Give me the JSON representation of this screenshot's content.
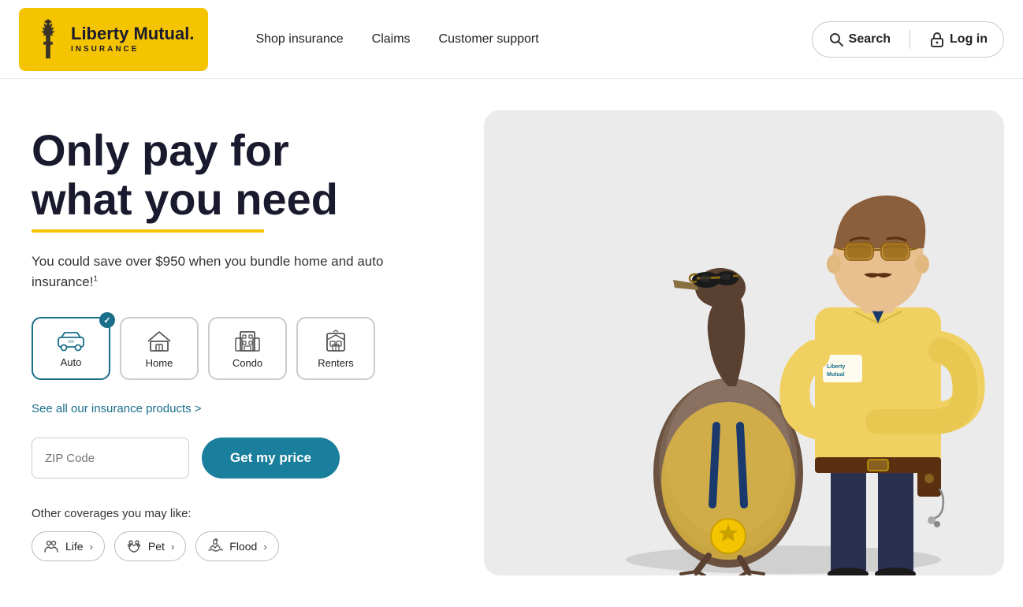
{
  "nav": {
    "logo": {
      "main": "Liberty Mutual.",
      "sub": "INSURANCE"
    },
    "links": [
      {
        "id": "shop",
        "label": "Shop insurance"
      },
      {
        "id": "claims",
        "label": "Claims"
      },
      {
        "id": "support",
        "label": "Customer support"
      }
    ],
    "search_label": "Search",
    "login_label": "Log in"
  },
  "hero": {
    "title_line1": "Only pay for",
    "title_line2": "what you need",
    "subtitle": "You could save over $950 when you bundle home and auto insurance!",
    "subtitle_sup": "1",
    "see_all_label": "See all our insurance products >",
    "zip_placeholder": "ZIP Code",
    "cta_label": "Get my price",
    "other_label": "Other coverages you may like:",
    "ins_tabs": [
      {
        "id": "auto",
        "label": "Auto",
        "active": true
      },
      {
        "id": "home",
        "label": "Home",
        "active": false
      },
      {
        "id": "condo",
        "label": "Condo",
        "active": false
      },
      {
        "id": "renters",
        "label": "Renters",
        "active": false
      }
    ],
    "coverage_pills": [
      {
        "id": "life",
        "label": "Life"
      },
      {
        "id": "pet",
        "label": "Pet"
      },
      {
        "id": "flood",
        "label": "Flood"
      }
    ]
  }
}
